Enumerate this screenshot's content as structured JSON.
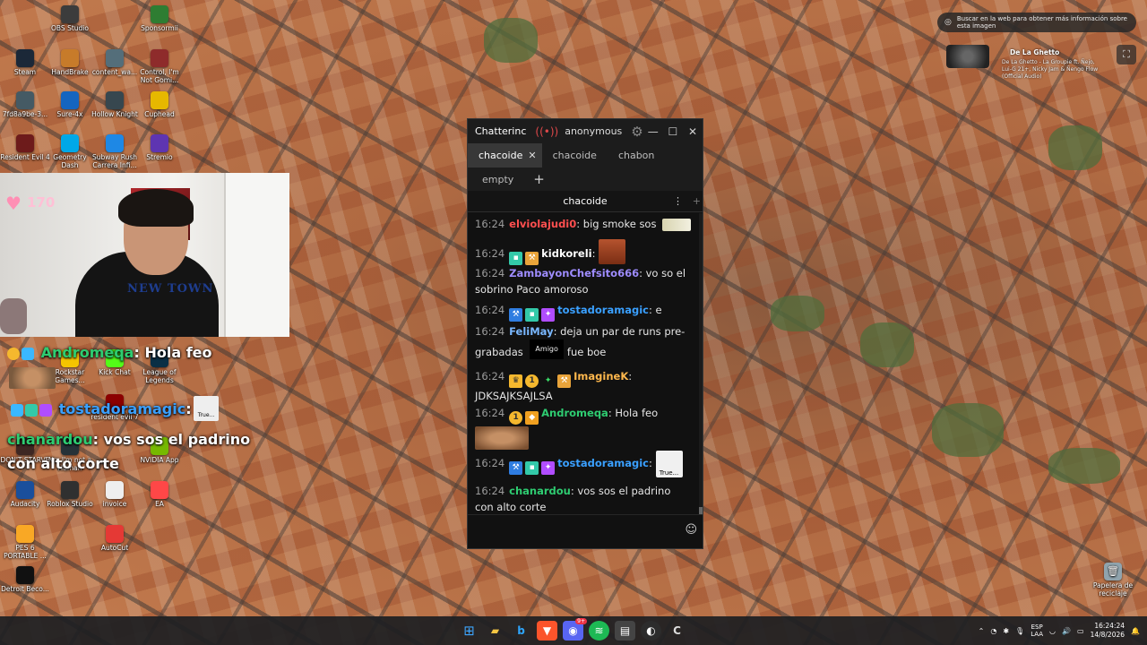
{
  "desktop": {
    "icons": [
      {
        "label": "OBS Studio",
        "color": "#3c3c3c"
      },
      {
        "label": "Sponsormii",
        "color": "#2e7d32"
      },
      {
        "label": "Steam",
        "color": "#1b2838"
      },
      {
        "label": "HandBrake",
        "color": "#c77b2a"
      },
      {
        "label": "content_wa...",
        "color": "#546e7a"
      },
      {
        "label": "Control, I'm Not Gomi...",
        "color": "#8e2b2b"
      },
      {
        "label": "7fd8a9be-3...",
        "color": "#455a64"
      },
      {
        "label": "Sure-4x",
        "color": "#1565c0"
      },
      {
        "label": "Hollow Knight",
        "color": "#37474f"
      },
      {
        "label": "Cuphead",
        "color": "#e6b800"
      },
      {
        "label": "Resident Evil 4",
        "color": "#6d1b1b"
      },
      {
        "label": "Geometry Dash",
        "color": "#00a8e8"
      },
      {
        "label": "Subway Rush Carrera Infi...",
        "color": "#1e88e5"
      },
      {
        "label": "Stremio",
        "color": "#5e35b1"
      },
      {
        "label": "Rockstar Games...",
        "color": "#f5c400"
      },
      {
        "label": "Kick Chat",
        "color": "#53fc18"
      },
      {
        "label": "League of Legends",
        "color": "#0a2f45"
      },
      {
        "label": "resident evil 7",
        "color": "#8b0000"
      },
      {
        "label": "DON'T STARVE",
        "color": "#3e2723"
      },
      {
        "label": "No, I'm not a Human",
        "color": "#263238"
      },
      {
        "label": "NVIDIA App",
        "color": "#76b900"
      },
      {
        "label": "Audacity",
        "color": "#1a4f9c"
      },
      {
        "label": "Roblox Studio",
        "color": "#303030"
      },
      {
        "label": "invoice",
        "color": "#eeeeee"
      },
      {
        "label": "EA",
        "color": "#ff4747"
      },
      {
        "label": "PES 6 PORTABLE ...",
        "color": "#f9a825"
      },
      {
        "label": "AutoCut",
        "color": "#e53935"
      },
      {
        "label": "Detroit Beco...",
        "color": "#111111"
      },
      {
        "label": "Papelera de reciclaje",
        "color": "#90a4ae"
      }
    ]
  },
  "webcam": {
    "heart_count": "170",
    "hoodie_text": "NEW TOWN"
  },
  "overlay_chat": [
    {
      "name": "Andromeqa",
      "sep": ":",
      "text": "Hola feo",
      "color": "#2ecc71"
    },
    {
      "name": "tostadoramagic",
      "sep": ":",
      "text": "",
      "color": "#3aa0ff"
    },
    {
      "name": "chanardou",
      "sep": ":",
      "text": "vos sos el padrino",
      "color": "#2ecc71"
    },
    {
      "name": "",
      "sep": "",
      "text": "con alto corte",
      "color": "#ffffff"
    }
  ],
  "overlay_true_label": "True...",
  "chatterino": {
    "app_name": "Chatterinc",
    "user": "anonymous",
    "tabs": [
      {
        "label": "chacoide",
        "active": true
      },
      {
        "label": "chacoide",
        "active": false
      },
      {
        "label": "chabon",
        "active": false
      }
    ],
    "tabs_row2": [
      {
        "label": "empty"
      }
    ],
    "channel": "chacoide",
    "tooltip": "Amigo",
    "true_label": "True...",
    "messages": [
      {
        "time": "16:24",
        "name": "elviolajudi0",
        "text": "big smoke sos",
        "color": "#ff4f4f"
      },
      {
        "time": "16:24",
        "name": "kidkoreli",
        "text": "",
        "color": "#ffffff"
      },
      {
        "time": "16:24",
        "name": "ZambayonChefsito666",
        "text": "vo so el sobrino Paco amoroso",
        "color": "#9e8cff"
      },
      {
        "time": "16:24",
        "name": "tostadoramagic",
        "text": "e",
        "color": "#3aa0ff"
      },
      {
        "time": "16:24",
        "name": "FeliMay",
        "text": "deja un par de runs pre-grabadas",
        "text2": "fue boe",
        "color": "#7ab8ff"
      },
      {
        "time": "16:24",
        "name": "ImagineK",
        "text": "JDKSAJKSAJLSA",
        "color": "#ffb84d"
      },
      {
        "time": "16:24",
        "name": "Andromeqa",
        "text": "Hola feo",
        "color": "#2ecc71"
      },
      {
        "time": "16:24",
        "name": "tostadoramagic",
        "text": "",
        "color": "#3aa0ff"
      },
      {
        "time": "16:24",
        "name": "chanardou",
        "text": "vos sos el padrino con alto corte",
        "color": "#2ecc71"
      }
    ]
  },
  "lens": {
    "text": "Buscar en la web para obtener más información sobre esta imagen"
  },
  "media": {
    "title": "De La Ghetto",
    "subtitle": "De La Ghetto - La Groupie ft. Ñejo, Lui-G 21+, Nicky Jam & Ñengo Flow (Official Audio)"
  },
  "taskbar": {
    "lang": "ESP",
    "lang2": "LAA",
    "time": "16:24:24",
    "date": "14/8/2026",
    "notify_badge": "9+"
  }
}
